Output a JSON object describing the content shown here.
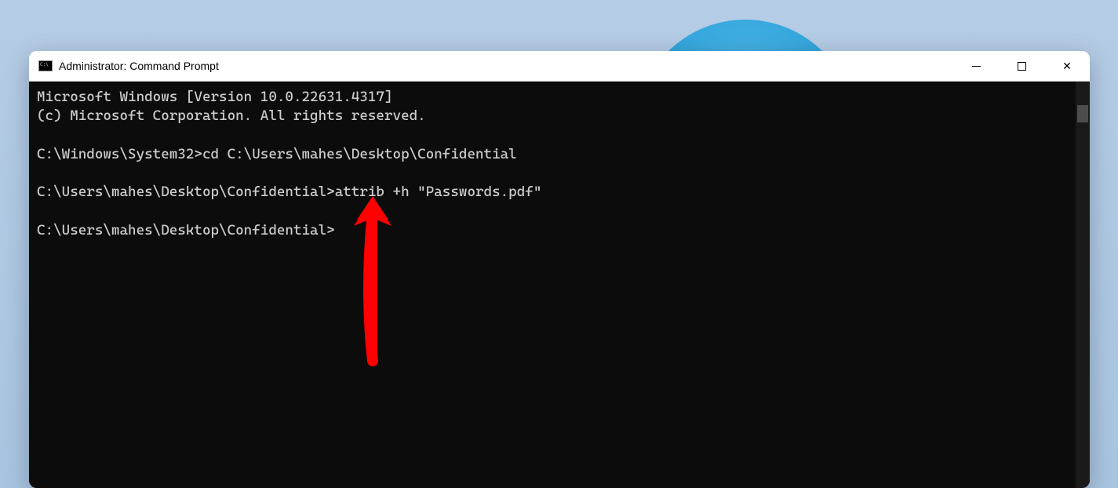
{
  "window": {
    "title": "Administrator: Command Prompt"
  },
  "terminal": {
    "line1": "Microsoft Windows [Version 10.0.22631.4317]",
    "line2": "(c) Microsoft Corporation. All rights reserved.",
    "blank1": "",
    "line3": "C:\\Windows\\System32>cd C:\\Users\\mahes\\Desktop\\Confidential",
    "blank2": "",
    "line4": "C:\\Users\\mahes\\Desktop\\Confidential>attrib +h \"Passwords.pdf\"",
    "blank3": "",
    "line5": "C:\\Users\\mahes\\Desktop\\Confidential>"
  },
  "annotation": {
    "color": "#ff0000"
  }
}
